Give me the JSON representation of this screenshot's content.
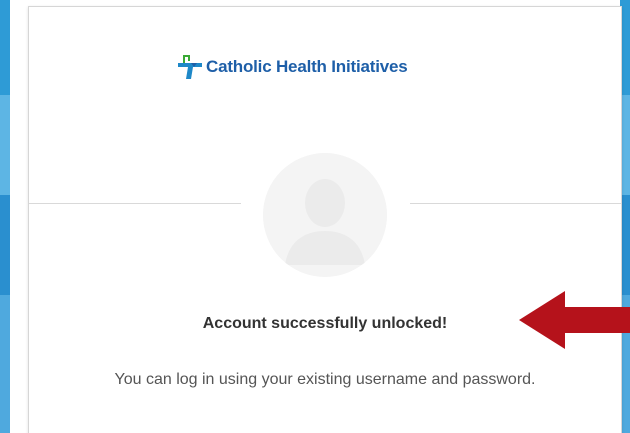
{
  "brand": {
    "name": "Catholic Health Initiatives",
    "icon": "chi-cross-logo-icon",
    "color": "#1e5fa8",
    "accent_green": "#3aa935"
  },
  "avatar": {
    "icon": "user-silhouette-icon"
  },
  "status": {
    "heading": "Account successfully unlocked!",
    "message": "You can log in using your existing username and password."
  },
  "annotation": {
    "icon": "red-arrow-left-icon",
    "color": "#b5121b"
  },
  "colors": {
    "page_background_blue": "#2e9bd6",
    "card_background": "#ffffff",
    "heading_text": "#333333",
    "body_text": "#555555"
  }
}
